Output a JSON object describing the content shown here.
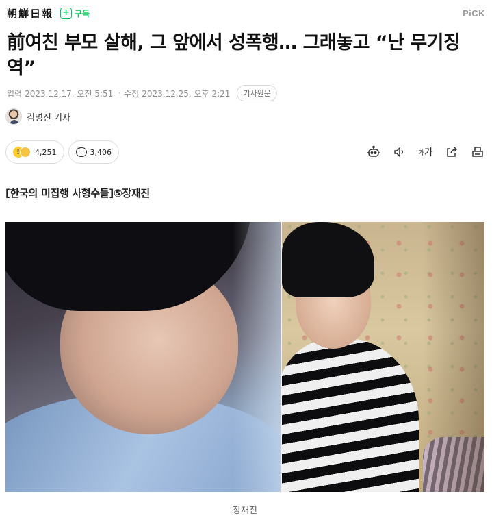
{
  "header": {
    "press_logo": "朝鮮日報",
    "subscribe_label": "구독",
    "pick_label": "PiCK"
  },
  "article": {
    "headline": "前여친 부모 살해, 그 앞에서 성폭행… 그래놓고 “난 무기징역”",
    "meta": {
      "input_label": "입력",
      "input_time": "2023.12.17. 오전 5:51",
      "separator": "·",
      "modified_label": "수정",
      "modified_time": "2023.12.25. 오후 2:21",
      "original_button": "기사원문"
    },
    "reporter": "김명진 기자",
    "reactions": {
      "count": "4,251"
    },
    "comments": {
      "count": "3,406"
    },
    "tools": [
      "summary-bot-icon",
      "speaker-icon",
      "font-size-icon",
      "share-icon",
      "print-icon"
    ],
    "font_size_label": "가가",
    "series_title": "[한국의 미집행 사형수들]⑤장재진",
    "photo_caption": "장재진"
  }
}
